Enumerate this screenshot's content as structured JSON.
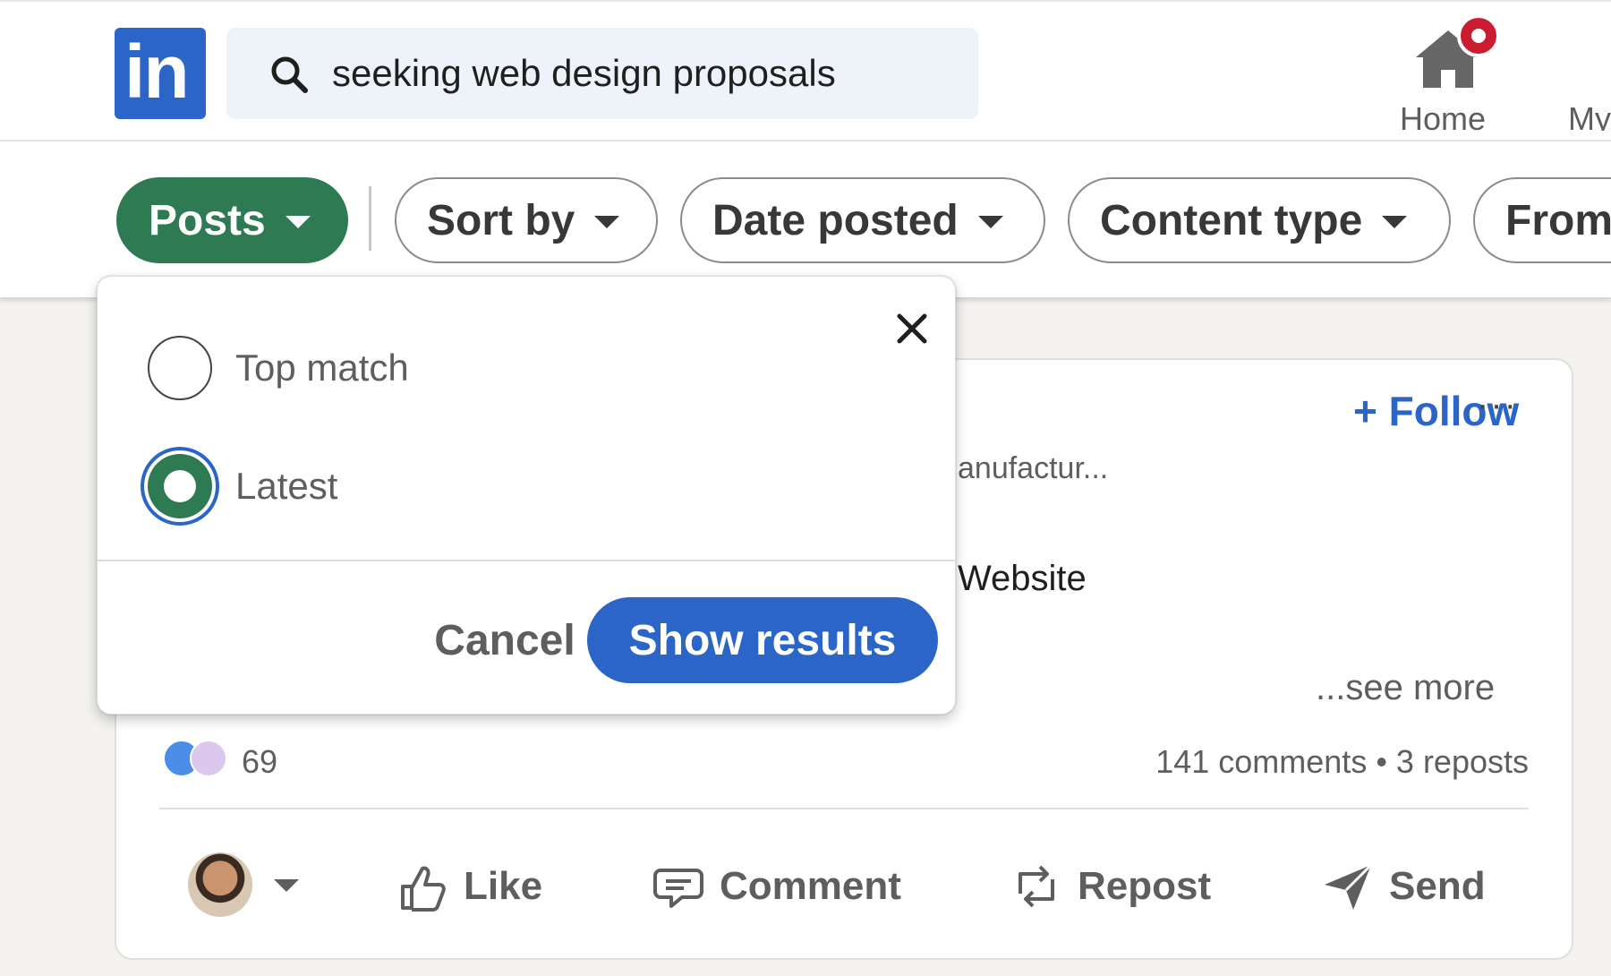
{
  "colors": {
    "brand_blue": "#2b65c8",
    "filter_active_green": "#2e7a52",
    "notification_red": "#cb1d32",
    "page_background": "#f3f2ef"
  },
  "header": {
    "logo_text": "in",
    "search": {
      "value": "seeking web design proposals",
      "icon": "search-icon"
    },
    "nav": [
      {
        "label": "Home",
        "icon": "home-icon",
        "has_notification_badge": true
      },
      {
        "label": "My",
        "icon": "my-network-icon"
      }
    ]
  },
  "filters": {
    "pills": [
      {
        "label": "Posts",
        "active": true
      },
      {
        "label": "Sort by",
        "active": false
      },
      {
        "label": "Date posted",
        "active": false
      },
      {
        "label": "Content type",
        "active": false
      },
      {
        "label": "From",
        "active": false
      }
    ]
  },
  "sort_dropdown": {
    "options": [
      {
        "label": "Top match",
        "selected": false
      },
      {
        "label": "Latest",
        "selected": true
      }
    ],
    "cancel_label": "Cancel",
    "show_results_label": "Show results"
  },
  "post": {
    "follow_label": "Follow",
    "more_label": "···",
    "subtitle_fragment": "anufactur...",
    "body_fragment": "Website",
    "see_more_label": "...see more",
    "reaction_count": "69",
    "engagement": "141 comments • 3 reposts",
    "actions": [
      {
        "label": "Like",
        "icon": "like-icon"
      },
      {
        "label": "Comment",
        "icon": "comment-icon"
      },
      {
        "label": "Repost",
        "icon": "repost-icon"
      },
      {
        "label": "Send",
        "icon": "send-icon"
      }
    ]
  }
}
